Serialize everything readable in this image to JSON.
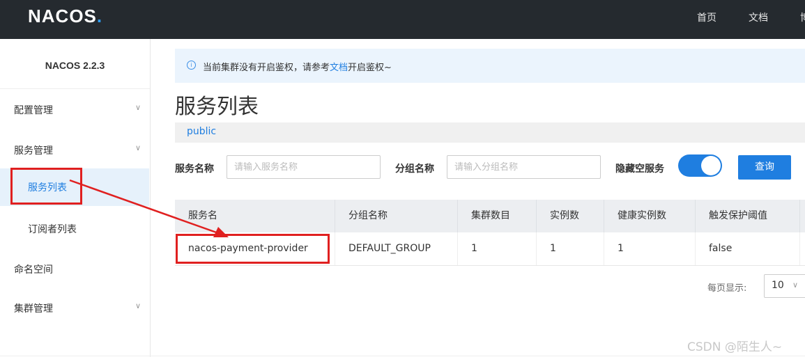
{
  "header": {
    "logo_text": "NACOS",
    "logo_dot": ".",
    "nav": [
      "首页",
      "文档",
      "博"
    ]
  },
  "sidebar": {
    "version": "NACOS 2.2.3",
    "items": [
      {
        "label": "配置管理",
        "expandable": true
      },
      {
        "label": "服务管理",
        "expandable": true
      },
      {
        "label": "服务列表",
        "active": true
      },
      {
        "label": "订阅者列表"
      },
      {
        "label": "命名空间"
      },
      {
        "label": "集群管理",
        "expandable": true
      }
    ],
    "chevron": "∨"
  },
  "notice": {
    "icon": "info-icon",
    "text_before": "当前集群没有开启鉴权，请参考",
    "link": "文档",
    "text_after": "开启鉴权~"
  },
  "page_title": "服务列表",
  "namespace": "public",
  "filters": {
    "service_name_label": "服务名称",
    "service_name_placeholder": "请输入服务名称",
    "group_name_label": "分组名称",
    "group_name_placeholder": "请输入分组名称",
    "hide_empty_label": "隐藏空服务",
    "hide_empty_on": true,
    "query_button": "查询"
  },
  "table": {
    "columns": [
      "服务名",
      "分组名称",
      "集群数目",
      "实例数",
      "健康实例数",
      "触发保护阈值"
    ],
    "rows": [
      [
        "nacos-payment-provider",
        "DEFAULT_GROUP",
        "1",
        "1",
        "1",
        "false"
      ]
    ]
  },
  "pagination": {
    "per_page_label": "每页显示:",
    "per_page_value": "10"
  },
  "watermark": "CSDN @陌生人~",
  "colors": {
    "topbar": "#252a2f",
    "accent": "#1f7ee0",
    "highlight": "#e02020"
  }
}
